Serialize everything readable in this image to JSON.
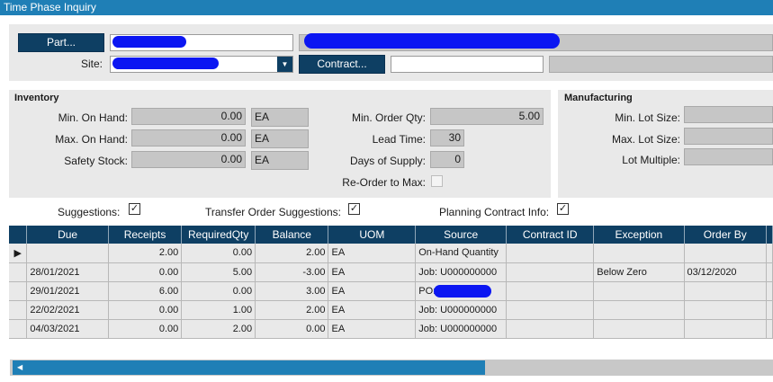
{
  "window": {
    "title": "Time Phase Inquiry"
  },
  "header": {
    "part_button": "Part...",
    "site_label": "Site:",
    "contract_button": "Contract...",
    "contract_value": ""
  },
  "inventory": {
    "title": "Inventory",
    "min_on_hand_label": "Min. On Hand:",
    "min_on_hand": "0.00",
    "min_on_hand_uom": "EA",
    "max_on_hand_label": "Max. On Hand:",
    "max_on_hand": "0.00",
    "max_on_hand_uom": "EA",
    "safety_stock_label": "Safety Stock:",
    "safety_stock": "0.00",
    "safety_stock_uom": "EA",
    "min_order_qty_label": "Min. Order Qty:",
    "min_order_qty": "5.00",
    "lead_time_label": "Lead Time:",
    "lead_time": "30",
    "days_of_supply_label": "Days of Supply:",
    "days_of_supply": "0",
    "reorder_to_max_label": "Re-Order to Max:"
  },
  "manufacturing": {
    "title": "Manufacturing",
    "min_lot_size_label": "Min. Lot Size:",
    "max_lot_size_label": "Max. Lot Size:",
    "lot_multiple_label": "Lot Multiple:"
  },
  "options": {
    "suggestions_label": "Suggestions:",
    "transfer_order_suggestions_label": "Transfer Order Suggestions:",
    "planning_contract_info_label": "Planning Contract Info:",
    "check_glyph": "✓",
    "row_pointer": "▶",
    "dropdown_glyph": "▼",
    "scroll_left_glyph": "◀"
  },
  "grid": {
    "columns": [
      "Due",
      "Receipts",
      "RequiredQty",
      "Balance",
      "UOM",
      "Source",
      "Contract ID",
      "Exception",
      "Order By"
    ],
    "rows": [
      [
        "",
        "2.00",
        "0.00",
        "2.00",
        "EA",
        "On-Hand Quantity",
        "",
        "",
        ""
      ],
      [
        "28/01/2021",
        "0.00",
        "5.00",
        "-3.00",
        "EA",
        "Job: U000000000",
        "",
        "Below Zero",
        "03/12/2020"
      ],
      [
        "29/01/2021",
        "6.00",
        "0.00",
        "3.00",
        "EA",
        "PO:",
        "",
        "",
        ""
      ],
      [
        "22/02/2021",
        "0.00",
        "1.00",
        "2.00",
        "EA",
        "Job: U000000000",
        "",
        "",
        ""
      ],
      [
        "04/03/2021",
        "0.00",
        "2.00",
        "0.00",
        "EA",
        "Job: U000000000",
        "",
        "",
        ""
      ]
    ]
  },
  "colors": {
    "accent": "#1f7fb6",
    "header_dark": "#0e3f63",
    "redaction": "#0b16f2"
  }
}
